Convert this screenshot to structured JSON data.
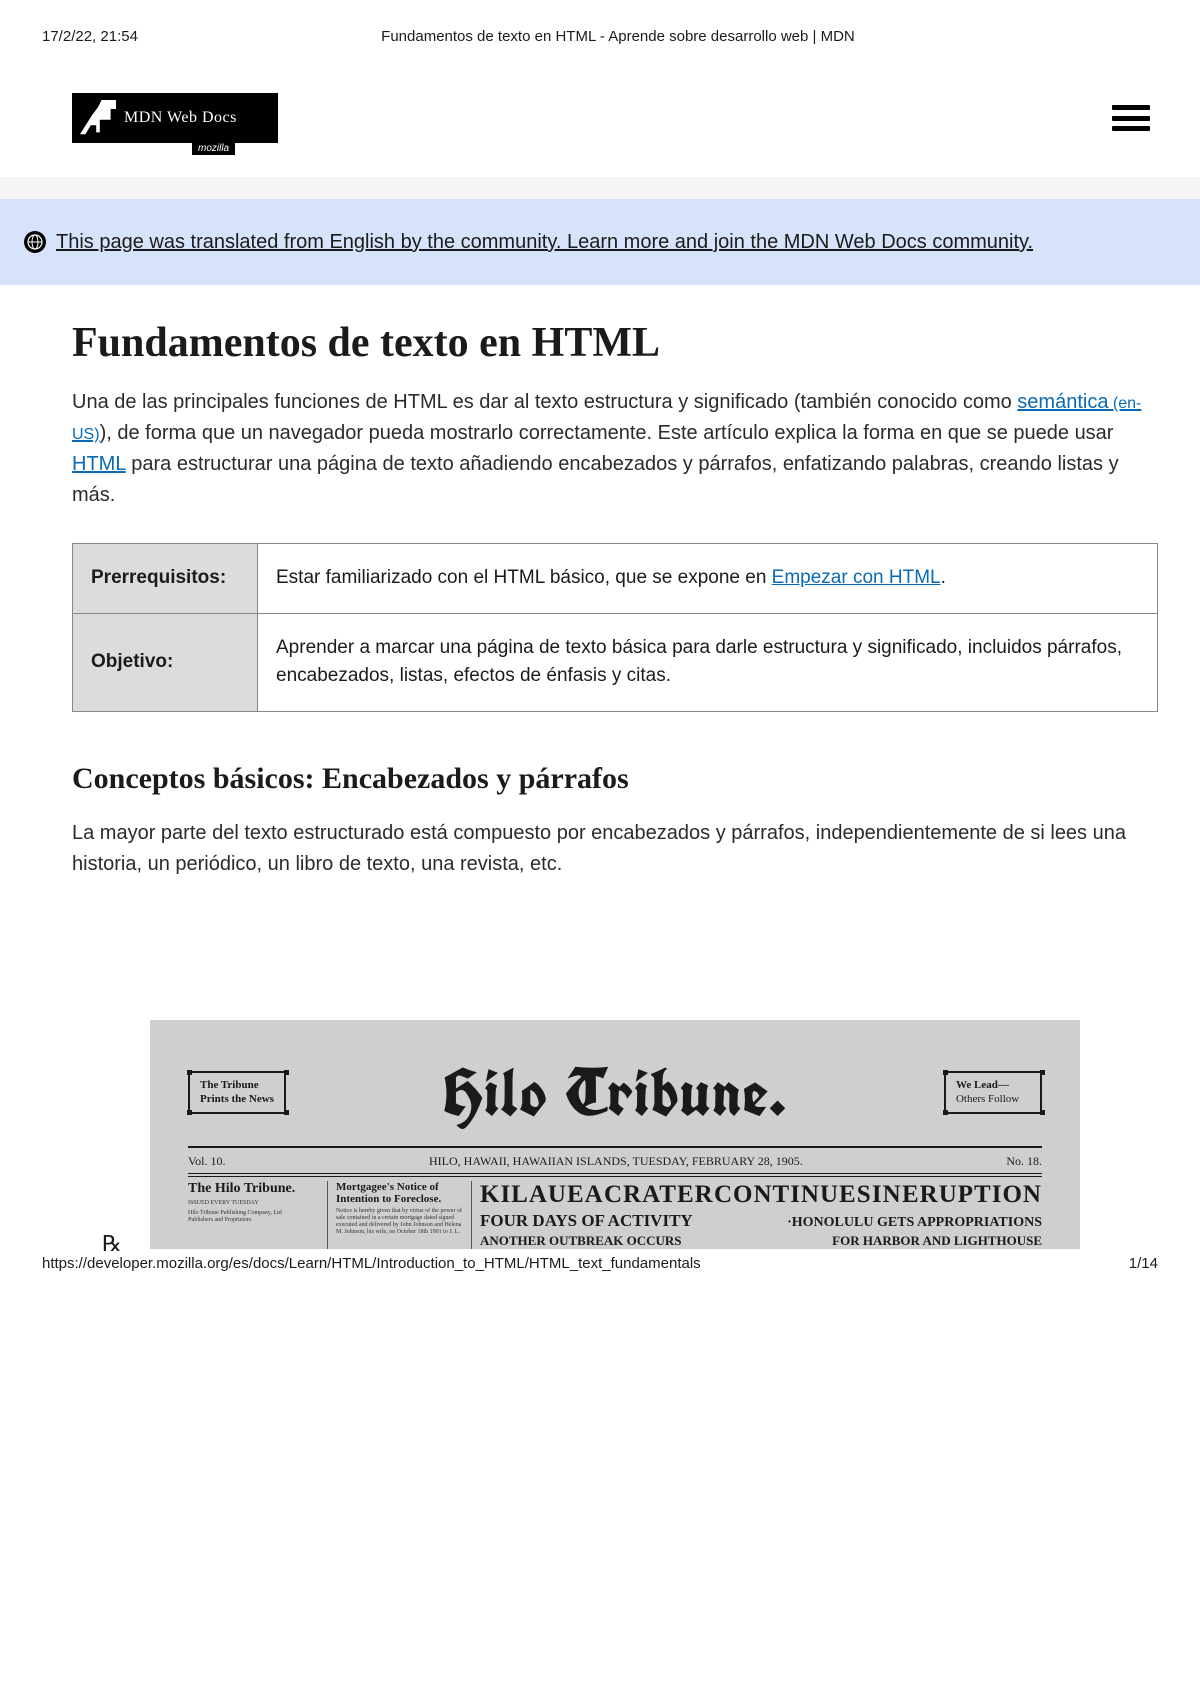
{
  "print": {
    "timestamp": "17/2/22, 21:54",
    "doc_title": "Fundamentos de texto en HTML - Aprende sobre desarrollo web | MDN",
    "footer_url": "https://developer.mozilla.org/es/docs/Learn/HTML/Introduction_to_HTML/HTML_text_fundamentals",
    "page_num": "1/14"
  },
  "logo": {
    "text": "MDN Web Docs",
    "sub": "mozilla"
  },
  "banner": {
    "text": "This page was translated from English by the community. Learn more and join the MDN Web Docs community."
  },
  "h1": "Fundamentos de texto en HTML",
  "intro": {
    "pre": "Una de las principales funciones de HTML es dar al texto estructura y significado (también conocido como ",
    "link1": "semántica",
    "locale": " (en-US)",
    "mid1": "), de forma que un navegador pueda mostrarlo correctamente. Este artículo explica la forma en que se puede usar ",
    "link2": "HTML",
    "mid2": " para estructurar una página de texto añadiendo encabezados y párrafos, enfatizando palabras, creando listas y más."
  },
  "table": {
    "row1_label": "Prerrequisitos:",
    "row1_pre": "Estar familiarizado con el HTML básico, que se expone en ",
    "row1_link": "Empezar con HTML",
    "row1_post": ".",
    "row2_label": "Objetivo:",
    "row2_val": "Aprender a marcar una página de texto básica para darle estructura y significado, incluidos párrafos, encabezados, listas, efectos de énfasis y citas."
  },
  "h2": "Conceptos básicos: Encabezados y párrafos",
  "para2": "La mayor parte del texto estructurado está compuesto por encabezados y párrafos, independientemente de si lees una historia, un periódico, un libro de texto, una revista, etc.",
  "newspaper": {
    "badge_left_1": "The Tribune",
    "badge_left_2": "Prints the News",
    "masthead": "Hilo Tribune.",
    "badge_right_1": "We Lead—",
    "badge_right_2": "Others Follow",
    "vol": "Vol. 10.",
    "dateline": "HILO, HAWAII, HAWAIIAN ISLANDS, TUESDAY, FEBRUARY 28, 1905.",
    "no": "No. 18.",
    "col1_h": "The Hilo Tribune.",
    "col2_a": "Mortgagee's Notice of",
    "col2_b": "Intention to Foreclose.",
    "headline_words": [
      "KILAUEA",
      "CRATER",
      "CONTINUES",
      "IN",
      "ERUPTION"
    ],
    "sub_left": "FOUR DAYS OF ACTIVITY",
    "sub_right": "HONOLULU GETS APPROPRIATIONS",
    "sub2_left": "ANOTHER OUTBREAK OCCURS",
    "sub2_right": "FOR HARBOR AND LIGHTHOUSE",
    "foot_glyph": "℞"
  }
}
